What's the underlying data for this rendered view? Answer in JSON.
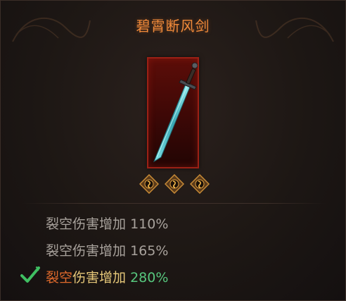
{
  "tooltip": {
    "title": "碧霄断风剑",
    "title_color": "#f08a3a",
    "item_icon": "sword-icon",
    "socket_icon": "rune-socket-icon",
    "socket_count": 3,
    "stats": [
      {
        "label": "裂空伤害增加",
        "value": "110%",
        "active": false
      },
      {
        "label": "裂空伤害增加",
        "value": "165%",
        "active": false
      },
      {
        "label_a": "裂空",
        "label_b": "伤害增加",
        "value": "280%",
        "active": true
      }
    ],
    "active_color": "#57c77e",
    "check_icon": "checkmark-icon"
  }
}
